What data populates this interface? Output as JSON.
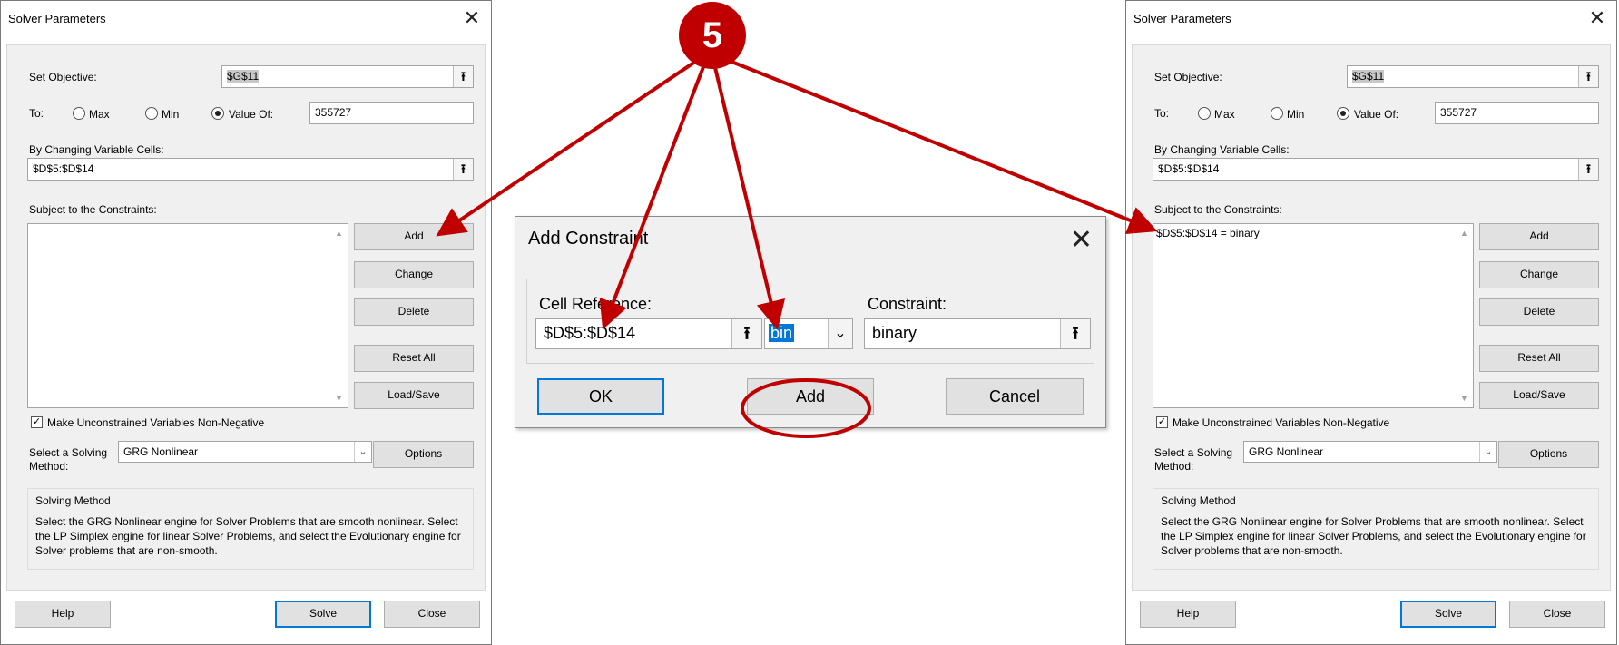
{
  "left_dialog": {
    "title": "Solver Parameters",
    "set_objective_label": "Set Objective:",
    "objective_value": "$G$11",
    "to_label": "To:",
    "max_label": "Max",
    "min_label": "Min",
    "value_of_label": "Value Of:",
    "value_of_value": "355727",
    "changing_label": "By Changing Variable Cells:",
    "changing_value": "$D$5:$D$14",
    "constraints_label": "Subject to the Constraints:",
    "constraints": [],
    "add": "Add",
    "change": "Change",
    "delete": "Delete",
    "reset_all": "Reset All",
    "load_save": "Load/Save",
    "nonneg_label": "Make Unconstrained Variables Non-Negative",
    "method_label_1": "Select a Solving",
    "method_label_2": "Method:",
    "method_value": "GRG Nonlinear",
    "options": "Options",
    "solving_method_title": "Solving Method",
    "solving_method_text": "Select the GRG Nonlinear engine for Solver Problems that are smooth nonlinear. Select the LP Simplex engine for linear Solver Problems, and select the Evolutionary engine for Solver problems that are non-smooth.",
    "help": "Help",
    "solve": "Solve",
    "close": "Close"
  },
  "right_dialog": {
    "title": "Solver Parameters",
    "set_objective_label": "Set Objective:",
    "objective_value": "$G$11",
    "to_label": "To:",
    "max_label": "Max",
    "min_label": "Min",
    "value_of_label": "Value Of:",
    "value_of_value": "355727",
    "changing_label": "By Changing Variable Cells:",
    "changing_value": "$D$5:$D$14",
    "constraints_label": "Subject to the Constraints:",
    "constraints": [
      "$D$5:$D$14 = binary"
    ],
    "add": "Add",
    "change": "Change",
    "delete": "Delete",
    "reset_all": "Reset All",
    "load_save": "Load/Save",
    "nonneg_label": "Make Unconstrained Variables Non-Negative",
    "method_label_1": "Select a Solving",
    "method_label_2": "Method:",
    "method_value": "GRG Nonlinear",
    "options": "Options",
    "solving_method_title": "Solving Method",
    "solving_method_text": "Select the GRG Nonlinear engine for Solver Problems that are smooth nonlinear. Select the LP Simplex engine for linear Solver Problems, and select the Evolutionary engine for Solver problems that are non-smooth.",
    "help": "Help",
    "solve": "Solve",
    "close": "Close"
  },
  "add_constraint": {
    "title": "Add Constraint",
    "cell_ref_label": "Cell Reference:",
    "cell_ref_value": "$D$5:$D$14",
    "operator_value": "bin",
    "constraint_label": "Constraint:",
    "constraint_value": "binary",
    "ok": "OK",
    "add": "Add",
    "cancel": "Cancel"
  },
  "annotation": {
    "step_number": "5",
    "color": "#c00000"
  }
}
